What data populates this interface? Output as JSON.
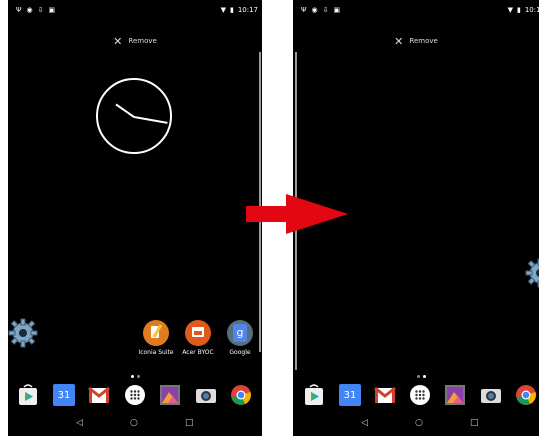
{
  "status_bar": {
    "time": "10:17"
  },
  "remove_bar": {
    "label": "Remove"
  },
  "apps": [
    {
      "label": "Iconia Suite",
      "icon": "iconia-suite-icon"
    },
    {
      "label": "Acer BYOC",
      "icon": "acer-byoc-icon"
    },
    {
      "label": "Google",
      "icon": "google-folder-icon"
    }
  ],
  "dock": {
    "calendar_label": "31",
    "icons": [
      "play-store-icon",
      "calendar-icon",
      "gmail-icon",
      "app-drawer-icon",
      "gallery-icon",
      "camera-icon",
      "chrome-icon"
    ]
  },
  "nav": {
    "back": "◁",
    "home": "○",
    "recents": "□"
  },
  "colors": {
    "arrow": "#e30613",
    "background": "#000000"
  }
}
